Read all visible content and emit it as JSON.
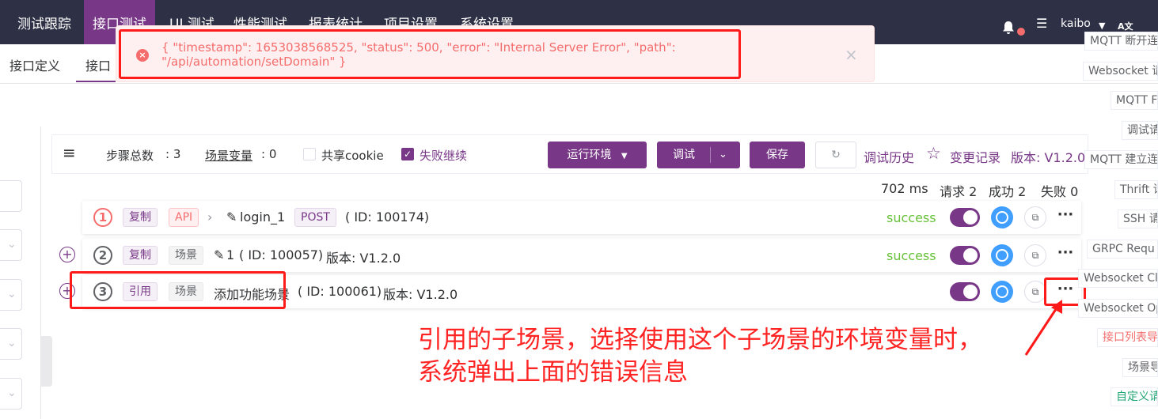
{
  "topnav": {
    "items": [
      "测试跟踪",
      "接口测试",
      "UI 测试",
      "性能测试",
      "报表统计",
      "项目设置",
      "系统设置"
    ],
    "user": "kaibo",
    "lang_icon": "A文"
  },
  "subnav": {
    "tabs": [
      "接口定义",
      "接口"
    ]
  },
  "error": {
    "message": "{ \"timestamp\": 1653038568525, \"status\": 500, \"error\": \"Internal Server Error\", \"path\": \"/api/automation/setDomain\" }"
  },
  "toolbar": {
    "menu_icon": "≡",
    "steps_label": "步骤总数",
    "steps_value": ": 3",
    "vars_label": "场景变量",
    "vars_value": ": 0",
    "share_cookie": "共享cookie",
    "fail_continue": "失败继续",
    "env_button": "运行环境",
    "debug_button": "调试",
    "save_button": "保存",
    "history": "调试历史",
    "changelog": "变更记录",
    "version": "版本: V1.2.0"
  },
  "stats": {
    "time": "702 ms",
    "requests": "请求 2",
    "success": "成功 2",
    "fail": "失败 0"
  },
  "steps": [
    {
      "num": "1",
      "tag1": "复制",
      "tag2": "API",
      "name": "login_1",
      "method": "POST",
      "id": "( ID: 100174)",
      "status": "success"
    },
    {
      "num": "2",
      "tag1": "复制",
      "tag2": "场景",
      "name": "1",
      "id": "( ID: 100057)",
      "version": "版本: V1.2.0",
      "status": "success"
    },
    {
      "num": "3",
      "tag1": "引用",
      "tag2": "场景",
      "name": "添加功能场景",
      "id": "( ID: 100061)",
      "version": "版本: V1.2.0",
      "status": ""
    }
  ],
  "annotation": {
    "line1": "引用的子场景，选择使用这个子场景的环境变量时，",
    "line2": "系统弹出上面的错误信息"
  },
  "right_panel": [
    "MQTT 断开连",
    "Websocket 请",
    "MQTT F",
    "调试请",
    "MQTT 建立连",
    "Thrift 请",
    "SSH 请",
    "GRPC Requ",
    "Websocket Clo",
    "Websocket Op",
    "接口列表导",
    "场景导",
    "自定义请"
  ],
  "colors": {
    "brand": "#783887",
    "nav_bg": "#2e3146",
    "error": "#f56c6c",
    "success": "#67c23a",
    "annotation": "#ff2424"
  }
}
